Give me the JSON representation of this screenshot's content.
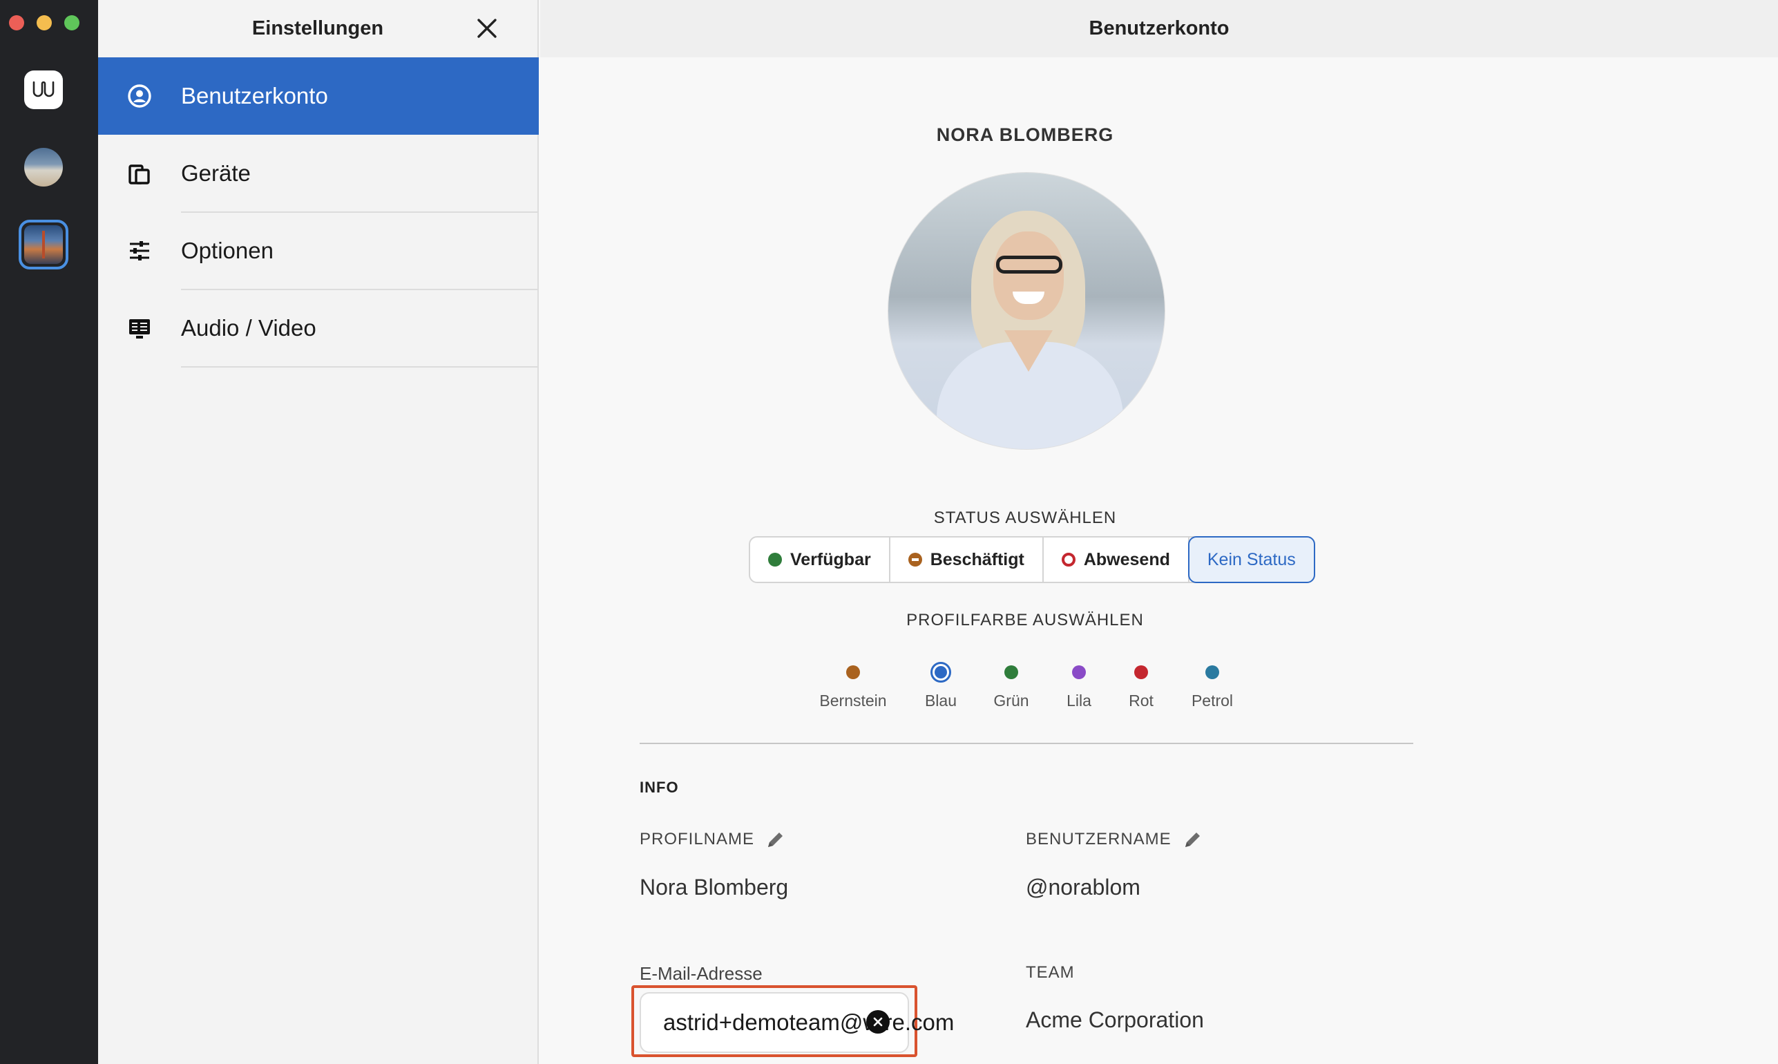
{
  "window": {
    "rail_logo_glyph": "ѡ"
  },
  "sidebar": {
    "title": "Einstellungen",
    "items": [
      {
        "label": "Benutzerkonto",
        "icon": "user-circle-icon",
        "active": true
      },
      {
        "label": "Geräte",
        "icon": "devices-icon",
        "active": false
      },
      {
        "label": "Optionen",
        "icon": "sliders-icon",
        "active": false
      },
      {
        "label": "Audio / Video",
        "icon": "audio-video-icon",
        "active": false
      }
    ]
  },
  "main": {
    "title": "Benutzerkonto",
    "profile_header": "NORA BLOMBERG",
    "status": {
      "label": "STATUS AUSWÄHLEN",
      "options": [
        {
          "label": "Verfügbar",
          "color": "#2f7d3b"
        },
        {
          "label": "Beschäftigt",
          "color": "#a9621f"
        },
        {
          "label": "Abwesend",
          "color": "#c4272f"
        },
        {
          "label": "Kein Status",
          "selected": true
        }
      ]
    },
    "profile_color": {
      "label": "PROFILFARBE AUSWÄHLEN",
      "options": [
        {
          "label": "Bernstein",
          "color": "#a9621f"
        },
        {
          "label": "Blau",
          "color": "#2d69c4",
          "selected": true
        },
        {
          "label": "Grün",
          "color": "#2f7d3b"
        },
        {
          "label": "Lila",
          "color": "#8a4bc7"
        },
        {
          "label": "Rot",
          "color": "#c4272f"
        },
        {
          "label": "Petrol",
          "color": "#2a7aa0"
        }
      ]
    },
    "info": {
      "heading": "INFO",
      "profile_name_label": "PROFILNAME",
      "profile_name_value": "Nora Blomberg",
      "username_label": "BENUTZERNAME",
      "username_value": "@norablom",
      "email_label": "E-Mail-Adresse",
      "email_value": "astrid+demoteam@wire.com",
      "team_label": "TEAM",
      "team_value": "Acme Corporation"
    }
  },
  "colors": {
    "accent": "#2d69c4",
    "highlight": "#d9532f",
    "rail": "#222326"
  }
}
